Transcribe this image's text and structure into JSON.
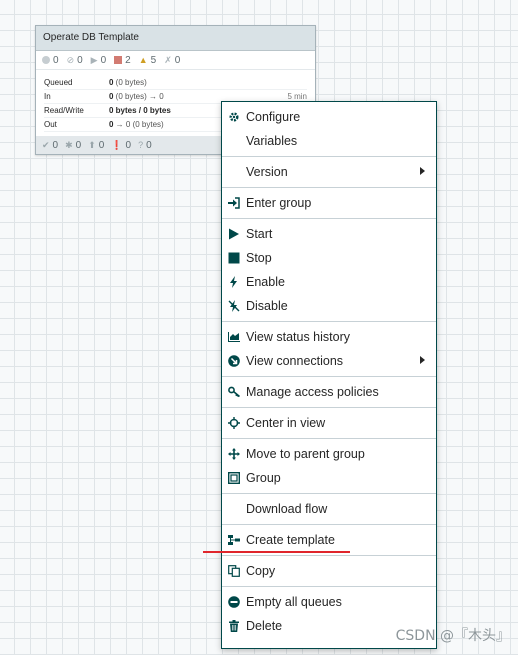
{
  "process_group": {
    "title": "Operate DB Template",
    "stats": {
      "transmitting": "0",
      "not_transmitting": "0",
      "running": "0",
      "stopped": "2",
      "invalid": "5",
      "disabled": "0"
    },
    "rows": [
      {
        "label": "Queued",
        "value_bold": "0",
        "value_rest": " (0 bytes)",
        "time": ""
      },
      {
        "label": "In",
        "value_bold": "0",
        "value_rest": " (0 bytes) → 0",
        "time": "5 min"
      },
      {
        "label": "Read/Write",
        "value_bold": "0 bytes / 0 bytes",
        "value_rest": "",
        "time": ""
      },
      {
        "label": "Out",
        "value_bold": "0",
        "value_rest": " → 0 (0 bytes)",
        "time": ""
      }
    ],
    "bottom": {
      "up_to_date": "0",
      "locally_modified": "0",
      "stale": "0",
      "modified_stale": "0",
      "sync_failure": "0"
    }
  },
  "menu": {
    "configure": "Configure",
    "variables": "Variables",
    "version": "Version",
    "enter_group": "Enter group",
    "start": "Start",
    "stop": "Stop",
    "enable": "Enable",
    "disable": "Disable",
    "view_status_history": "View status history",
    "view_connections": "View connections",
    "manage_access_policies": "Manage access policies",
    "center_in_view": "Center in view",
    "move_to_parent_group": "Move to parent group",
    "group": "Group",
    "download_flow": "Download flow",
    "create_template": "Create template",
    "copy": "Copy",
    "empty_all_queues": "Empty all queues",
    "delete": "Delete"
  },
  "watermark": "CSDN @『木头』",
  "colors": {
    "menu_border": "#004849",
    "highlight_underline": "#e0262c",
    "stopped": "#d27b72",
    "invalid": "#cf9f24"
  }
}
